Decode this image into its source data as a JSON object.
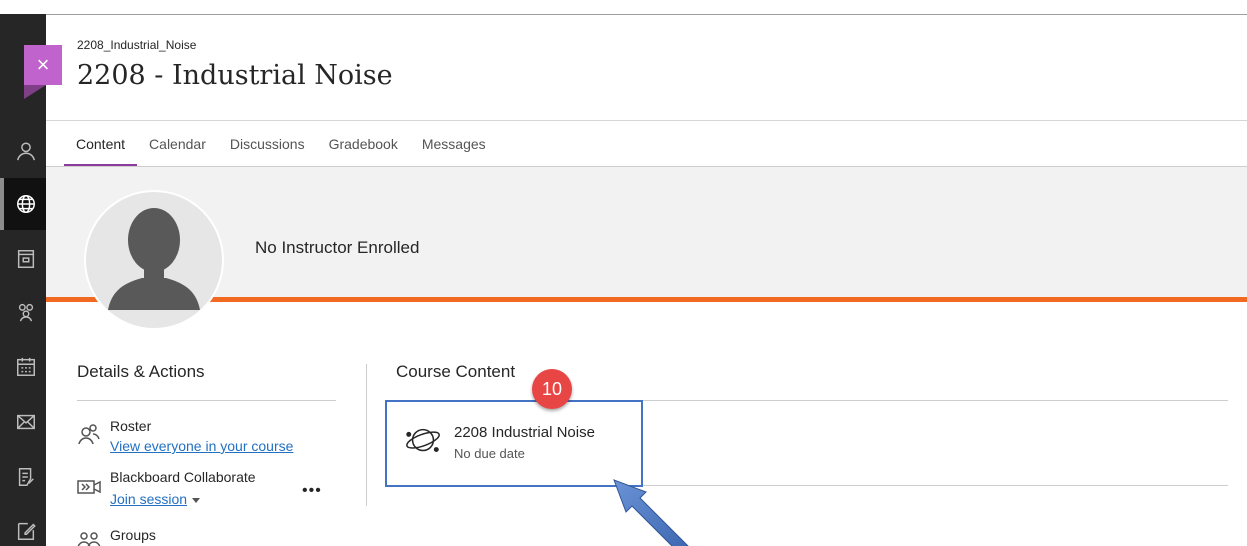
{
  "header": {
    "course_id": "2208_Industrial_Noise",
    "course_title": "2208 - Industrial Noise",
    "close_symbol": "×"
  },
  "tabs": [
    {
      "label": "Content",
      "active": true
    },
    {
      "label": "Calendar",
      "active": false
    },
    {
      "label": "Discussions",
      "active": false
    },
    {
      "label": "Gradebook",
      "active": false
    },
    {
      "label": "Messages",
      "active": false
    }
  ],
  "banner": {
    "instructor_text": "No Instructor Enrolled",
    "accent_color": "#f26a21"
  },
  "details": {
    "title": "Details & Actions",
    "roster_label": "Roster",
    "roster_link": "View everyone in your course",
    "collaborate_label": "Blackboard Collaborate",
    "collaborate_link": "Join session",
    "more_label": "•••",
    "groups_label": "Groups"
  },
  "content": {
    "title": "Course Content",
    "item_title": "2208 Industrial Noise",
    "item_due": "No due date"
  },
  "annotation": {
    "badge_number": "10",
    "box_color": "#4472c4",
    "badge_color": "#e84545"
  },
  "icons": [
    "close-icon",
    "user-icon",
    "globe-icon",
    "courses-icon",
    "people-icon",
    "calendar-icon",
    "mail-icon",
    "grades-icon",
    "edit-icon",
    "roster-icon",
    "video-icon",
    "groups-icon",
    "orbit-icon"
  ]
}
